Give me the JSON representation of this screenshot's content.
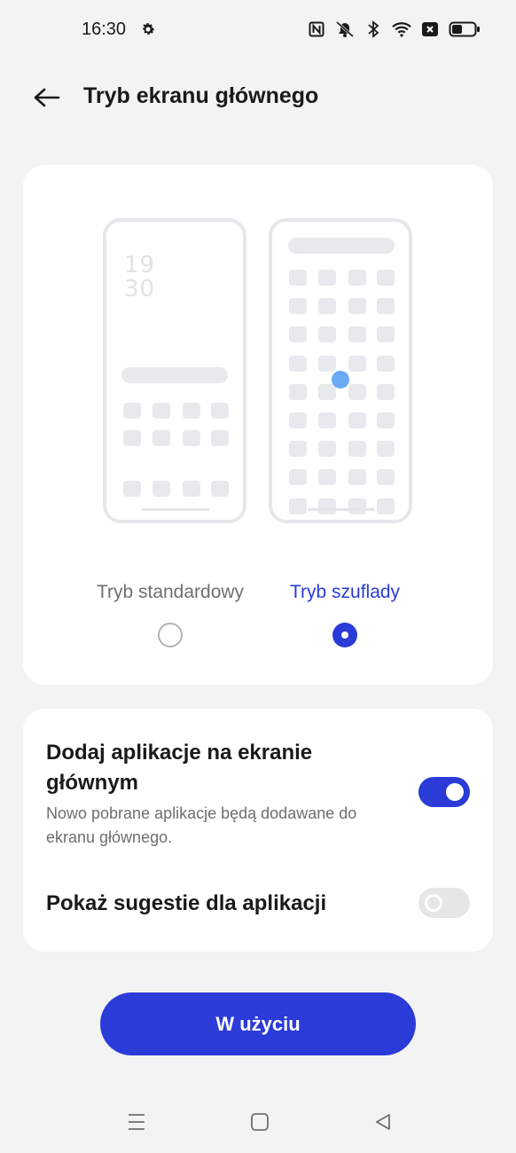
{
  "status_bar": {
    "time": "16:30",
    "icons": [
      "settings-gear-icon",
      "nfc-icon",
      "mute-icon",
      "bluetooth-icon",
      "wifi-icon",
      "no-sim-icon",
      "battery-icon"
    ]
  },
  "header": {
    "title": "Tryb ekranu głównego",
    "back_icon": "arrow-left-icon"
  },
  "modes": {
    "preview_clock_line1": "19",
    "preview_clock_line2": "30",
    "standard_label": "Tryb standardowy",
    "drawer_label": "Tryb szuflady",
    "selected": "drawer"
  },
  "settings": {
    "add_apps_title": "Dodaj aplikacje na ekranie głównym",
    "add_apps_desc": "Nowo pobrane aplikacje będą dodawane do ekranu głównego.",
    "add_apps_enabled": true,
    "suggestions_title": "Pokaż sugestie dla aplikacji",
    "suggestions_enabled": false
  },
  "action": {
    "label": "W użyciu"
  },
  "colors": {
    "accent": "#2b3bd8",
    "background": "#f3f3f3",
    "card": "#ffffff",
    "preview_dot": "#6aaaf5"
  },
  "nav": {
    "icons": [
      "menu-icon",
      "home-icon",
      "back-triangle-icon"
    ]
  }
}
